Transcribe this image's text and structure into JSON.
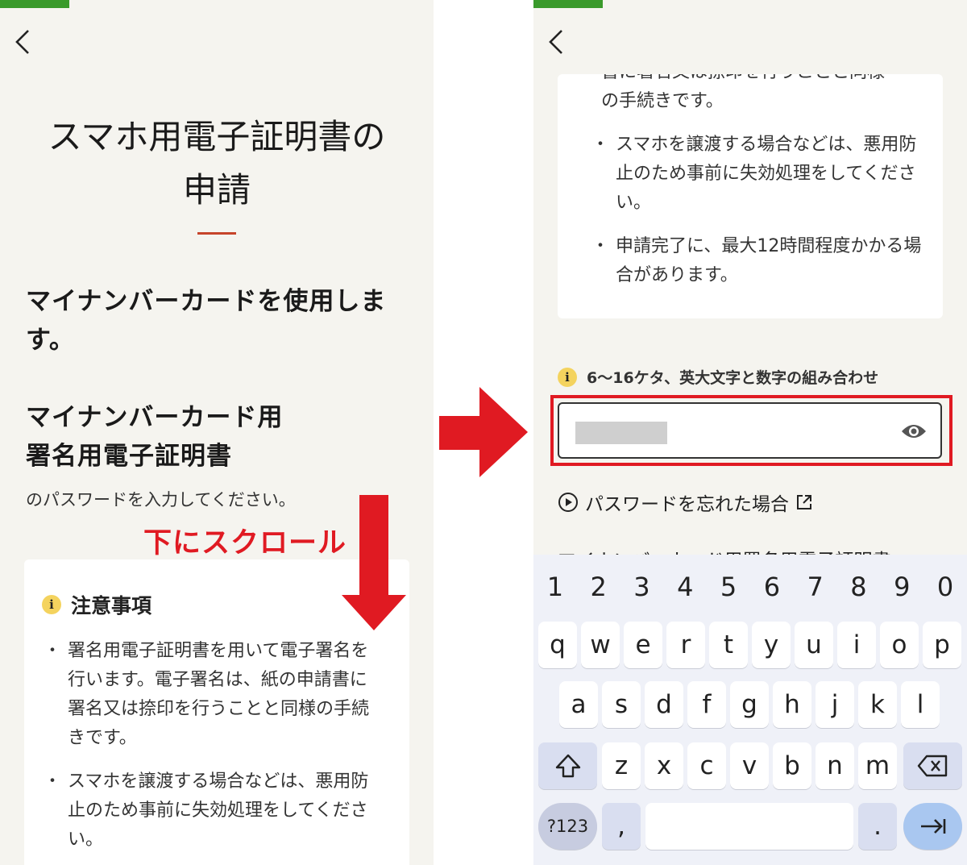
{
  "colors": {
    "accent_green": "#3a9a2b",
    "annotation_red": "#e01a22",
    "title_rule": "#c6442a",
    "info_yellow": "#f4d35e",
    "key_mod": "#d9def0",
    "enter_key": "#a9c7f0"
  },
  "left": {
    "title_line1": "スマホ用電子証明書の",
    "title_line2": "申請",
    "heading_card_line1": "マイナンバーカードを使用しま",
    "heading_card_line2": "す。",
    "heading_cert_line1": "マイナンバーカード用",
    "heading_cert_line2": "署名用電子証明書",
    "instruction": "のパスワードを入力してください。",
    "scroll_annotation": "下にスクロール",
    "notice": {
      "icon_glyph": "i",
      "heading": "注意事項",
      "items": [
        "署名用電子証明書を用いて電子署名を行います。電子署名は、紙の申請書に署名又は捺印を行うことと同様の手続きです。",
        "スマホを譲渡する場合などは、悪用防止のため事前に失効処理をしてください。"
      ]
    }
  },
  "right": {
    "cut_top_text": "書に署名又は捺印を行うことと同様",
    "card_continued": "の手続きです。",
    "items": [
      "スマホを譲渡する場合などは、悪用防止のため事前に失効処理をしてください。",
      "申請完了に、最大12時間程度かかる場合があります。"
    ],
    "hint_icon": "i",
    "password_hint": "6〜16ケタ、英大文字と数字の組み合わせ",
    "forgot_password": "パスワードを忘れた場合",
    "cut_bottom_text": "マイナンバーカード用署名用電子証明書"
  },
  "keyboard": {
    "numbers": [
      "1",
      "2",
      "3",
      "4",
      "5",
      "6",
      "7",
      "8",
      "9",
      "0"
    ],
    "row1": [
      "q",
      "w",
      "e",
      "r",
      "t",
      "y",
      "u",
      "i",
      "o",
      "p"
    ],
    "row2": [
      "a",
      "s",
      "d",
      "f",
      "g",
      "h",
      "j",
      "k",
      "l"
    ],
    "row3": [
      "z",
      "x",
      "c",
      "v",
      "b",
      "n",
      "m"
    ],
    "symbols_key": "?123",
    "comma_key": ",",
    "period_key": "."
  },
  "icons": {
    "back": "chevron-left-icon",
    "eye": "eye-icon",
    "play": "play-circle-icon",
    "external": "external-link-icon",
    "shift": "shift-icon",
    "backspace": "backspace-icon",
    "enter": "tab-enter-icon"
  }
}
